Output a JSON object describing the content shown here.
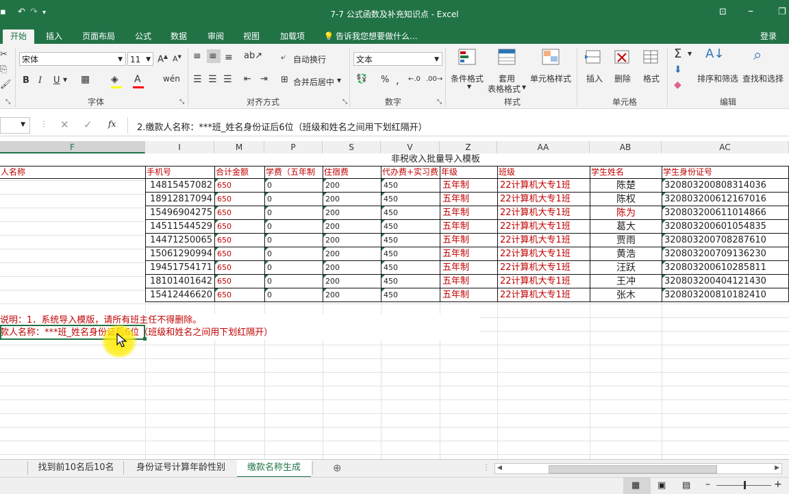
{
  "window": {
    "title": "7-7 公式函数及补充知识点 - Excel",
    "qat_more": "▾"
  },
  "tabs": [
    {
      "label": "开始"
    },
    {
      "label": "插入"
    },
    {
      "label": "页面布局"
    },
    {
      "label": "公式"
    },
    {
      "label": "数据"
    },
    {
      "label": "审阅"
    },
    {
      "label": "视图"
    },
    {
      "label": "加载项"
    }
  ],
  "tell_me": "告诉我您想要做什么...",
  "login": "登录",
  "ribbon": {
    "font": {
      "name": "宋体",
      "size": "11",
      "group_label": "字体",
      "bold": "B",
      "italic": "I",
      "underline": "U"
    },
    "alignment": {
      "wrap_text": "自动换行",
      "merge_center": "合并后居中",
      "group_label": "对齐方式"
    },
    "number": {
      "format": "文本",
      "group_label": "数字",
      "percent": "%"
    },
    "styles": {
      "conditional": "条件格式",
      "table_fmt_1": "套用",
      "table_fmt_2": "表格格式",
      "cell_styles": "单元格样式",
      "group_label": "样式"
    },
    "cells": {
      "insert": "插入",
      "delete": "删除",
      "format": "格式",
      "group_label": "单元格"
    },
    "editing": {
      "sort_filter": "排序和筛选",
      "find_select": "查找和选择",
      "group_label": "编辑"
    }
  },
  "formula_bar": {
    "fx": "fx",
    "content": "2.缴款人名称：***班_姓名身份证后6位（班级和姓名之间用下划红隔开）"
  },
  "columns": [
    "F",
    "I",
    "M",
    "P",
    "S",
    "V",
    "Z",
    "AA",
    "AB",
    "AC"
  ],
  "sheet": {
    "title": "非税收入批量导入模板",
    "headers": [
      "人名称",
      "手机号",
      "合计金额",
      "学费（五年制",
      "住宿费",
      "代办费+实习费",
      "年级",
      "班级",
      "学生姓名",
      "学生身份证号"
    ],
    "rows": [
      [
        "14815457082",
        "650",
        "0",
        "200",
        "450",
        "五年制",
        "22计算机大专1班",
        "陈楚",
        "320803200808314036"
      ],
      [
        "18912817094",
        "650",
        "0",
        "200",
        "450",
        "五年制",
        "22计算机大专1班",
        "陈权",
        "320803200612167016"
      ],
      [
        "15496904275",
        "650",
        "0",
        "200",
        "450",
        "五年制",
        "22计算机大专1班",
        "陈为",
        "320803200611014866"
      ],
      [
        "14511544529",
        "650",
        "0",
        "200",
        "450",
        "五年制",
        "22计算机大专1班",
        "葛大",
        "320803200601054835"
      ],
      [
        "14471250065",
        "650",
        "0",
        "200",
        "450",
        "五年制",
        "22计算机大专1班",
        "贾雨",
        "320803200708287610"
      ],
      [
        "15061290994",
        "650",
        "0",
        "200",
        "450",
        "五年制",
        "22计算机大专1班",
        "黄浩",
        "320803200709136230"
      ],
      [
        "19451754171",
        "650",
        "0",
        "200",
        "450",
        "五年制",
        "22计算机大专1班",
        "汪跃",
        "320803200610285811"
      ],
      [
        "18101401642",
        "650",
        "0",
        "200",
        "450",
        "五年制",
        "22计算机大专1班",
        "王冲",
        "320803200404121430"
      ],
      [
        "15412446620",
        "650",
        "0",
        "200",
        "450",
        "五年制",
        "22计算机大专1班",
        "张木",
        "320803200810182410"
      ]
    ],
    "note1": "说明：1．系统导入模版，请所有班主任不得删除。",
    "note2": "款人名称：***班_姓名身份证后6位（班级和姓名之间用下划红隔开）"
  },
  "sheet_tabs": [
    {
      "label": "找到前10名后10名",
      "active": false
    },
    {
      "label": "身份证号计算年龄性别",
      "active": false
    },
    {
      "label": "缴款名称生成",
      "active": true
    }
  ],
  "colors": {
    "excel_green": "#217346",
    "red_text": "#c00000"
  }
}
